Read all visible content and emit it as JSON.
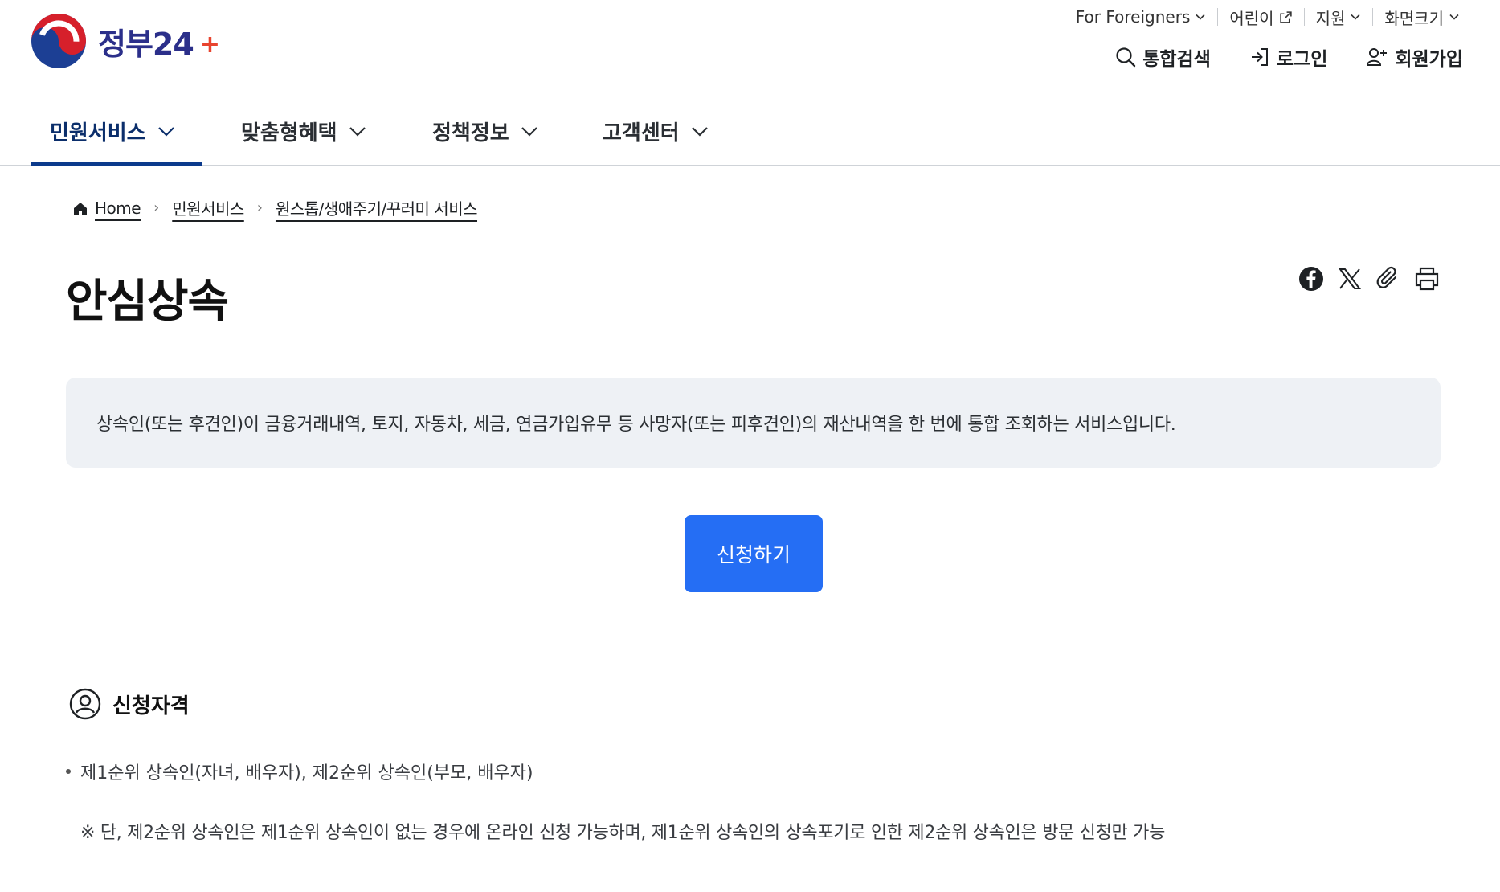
{
  "header": {
    "logo_text": "정부24",
    "utility": [
      {
        "label": "For Foreigners",
        "icon": "chevron-down-icon"
      },
      {
        "label": "어린이",
        "icon": "external-link-icon"
      },
      {
        "label": "지원",
        "icon": "chevron-down-icon"
      },
      {
        "label": "화면크기",
        "icon": "chevron-down-icon"
      }
    ],
    "actions": {
      "search": "통합검색",
      "login": "로그인",
      "signup": "회원가입"
    }
  },
  "gnb": {
    "items": [
      {
        "label": "민원서비스",
        "active": true
      },
      {
        "label": "맞춤형혜택",
        "active": false
      },
      {
        "label": "정책정보",
        "active": false
      },
      {
        "label": "고객센터",
        "active": false
      }
    ]
  },
  "breadcrumb": {
    "home": "Home",
    "level1": "민원서비스",
    "level2": "원스톱/생애주기/꾸러미 서비스"
  },
  "page": {
    "title": "안심상속",
    "description": "상속인(또는 후견인)이 금융거래내역, 토지, 자동차, 세금, 연금가입유무 등 사망자(또는 피후견인)의 재산내역을 한 번에 통합 조회하는 서비스입니다.",
    "apply_button": "신청하기"
  },
  "section": {
    "heading": "신청자격",
    "bullet": "제1순위 상속인(자녀, 배우자), 제2순위 상속인(부모, 배우자)",
    "note": "※ 단, 제2순위 상속인은 제1순위 상속인이 없는 경우에 온라인 신청 가능하며, 제1순위 상속인의 상속포기로 인한 제2순위 상속인은 방문 신청만 가능"
  },
  "colors": {
    "primary": "#256ef4",
    "gnb_active": "#0b3a8c",
    "desc_bg": "#eef1f5"
  }
}
